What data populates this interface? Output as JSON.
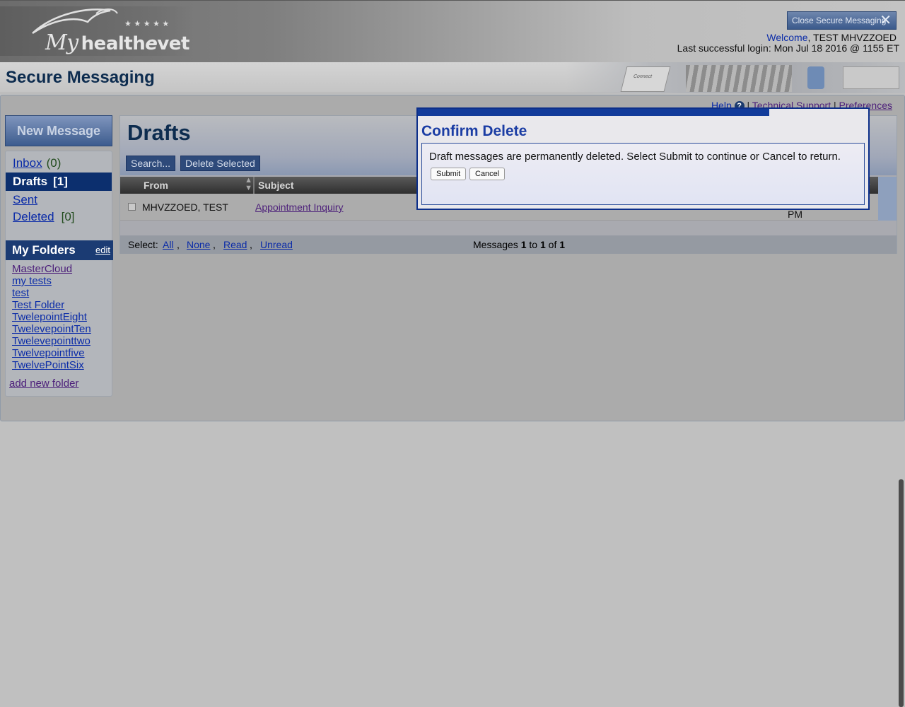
{
  "header": {
    "logo_my": "My",
    "logo_health": "health",
    "logo_e": "e",
    "logo_vet": "vet",
    "close_button_label": "Close Secure Messaging",
    "welcome_word": "Welcome",
    "user_name": ", TEST MHVZZOED",
    "last_login": "Last successful login: Mon Jul 18 2016 @ 1155 ET"
  },
  "title_bar": {
    "title": "Secure Messaging",
    "photo_key_text": "Connect"
  },
  "top_links": {
    "help": "Help",
    "help_icon_glyph": "?",
    "separator": "|",
    "technical_support": "Technical Support",
    "preferences": "Preferences"
  },
  "nav": {
    "new_message": "New Message",
    "items": [
      {
        "label": "Inbox",
        "count": "(0)"
      },
      {
        "label": "Drafts",
        "count": "[1]"
      },
      {
        "label": "Sent",
        "count": ""
      },
      {
        "label": "Deleted",
        "count": "[0]"
      }
    ],
    "folders_title": "My Folders",
    "folders_edit": "edit",
    "folders": [
      "MasterCloud",
      "my tests",
      "test",
      "Test Folder",
      "TwelepointEight",
      "TwelevepointTen",
      "Twelevepointtwo",
      "Twelvepointfive",
      "TwelvePointSix"
    ],
    "add_folder": "add new folder"
  },
  "content": {
    "title": "Drafts",
    "search_button": "Search...",
    "delete_selected_button": "Delete Selected",
    "columns": {
      "from": "From",
      "subject": "Subject"
    },
    "rows": [
      {
        "from": "MHVZZOED, TEST",
        "subject": "Appointment Inquiry",
        "date_tail": "PM"
      }
    ],
    "footer": {
      "select_label": "Select:",
      "all": "All",
      "none": "None",
      "read": "Read",
      "unread": "Unread",
      "messages_prefix": "Messages",
      "from_num": "1",
      "to_word": "to",
      "to_num": "1",
      "of_word": "of",
      "total": "1"
    }
  },
  "dialog": {
    "title": "Confirm Delete",
    "message": "Draft messages are permanently deleted. Select Submit to continue or Cancel to return.",
    "submit": "Submit",
    "cancel": "Cancel"
  },
  "colors": {
    "brand_navy": "#0c2f6e",
    "dialog_border": "#0d2f8a",
    "link_blue": "#0a2ba8",
    "link_visited": "#4c1f7a",
    "title_navy": "#0d2c4f"
  }
}
